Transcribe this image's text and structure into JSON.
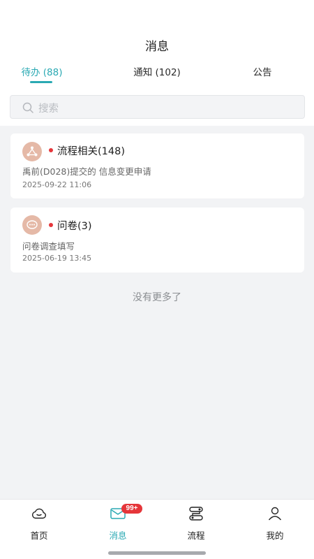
{
  "header": {
    "title": "消息",
    "tabs": [
      {
        "label": "待办 (88)",
        "active": true
      },
      {
        "label": "通知 (102)",
        "active": false
      },
      {
        "label": "公告",
        "active": false
      }
    ]
  },
  "search": {
    "placeholder": "搜索"
  },
  "cards": [
    {
      "icon": "workflow-icon",
      "title": "流程相关(148)",
      "description": "禹前(D028)提交的 信息变更申请",
      "time": "2025-09-22 11:06"
    },
    {
      "icon": "chat-bubble-icon",
      "title": "问卷(3)",
      "description": "问卷调查填写",
      "time": "2025-06-19 13:45"
    }
  ],
  "footer_hint": "没有更多了",
  "bottom_nav": [
    {
      "label": "首页",
      "icon": "cloud-home-icon"
    },
    {
      "label": "消息",
      "icon": "message-icon",
      "badge": "99+",
      "active": true
    },
    {
      "label": "流程",
      "icon": "process-icon"
    },
    {
      "label": "我的",
      "icon": "person-icon"
    }
  ],
  "colors": {
    "accent": "#2aa9b3",
    "badge": "#e5363a",
    "card_icon_bg": "#e5b9a7",
    "background": "#f2f3f5"
  }
}
